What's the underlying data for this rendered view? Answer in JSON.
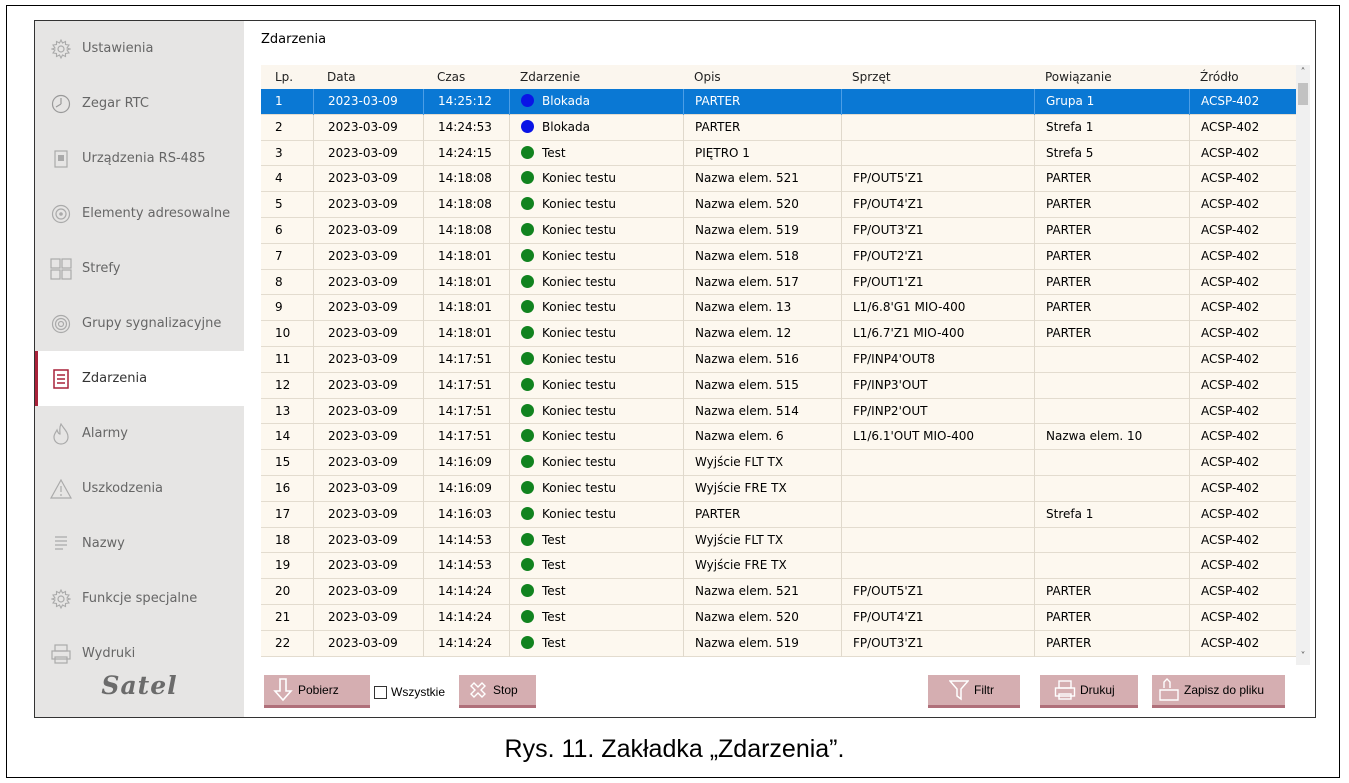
{
  "sidebar": {
    "items": [
      {
        "label": "Ustawienia",
        "icon": "gear-icon"
      },
      {
        "label": "Zegar RTC",
        "icon": "clock-icon"
      },
      {
        "label": "Urządzenia RS-485",
        "icon": "device-icon"
      },
      {
        "label": "Elementy adresowalne",
        "icon": "sensor-icon"
      },
      {
        "label": "Strefy",
        "icon": "grid-icon"
      },
      {
        "label": "Grupy sygnalizacyjne",
        "icon": "signal-icon"
      },
      {
        "label": "Zdarzenia",
        "icon": "events-icon",
        "active": true
      },
      {
        "label": "Alarmy",
        "icon": "flame-icon"
      },
      {
        "label": "Uszkodzenia",
        "icon": "warning-icon"
      },
      {
        "label": "Nazwy",
        "icon": "list-icon"
      },
      {
        "label": "Funkcje specjalne",
        "icon": "gear-icon"
      },
      {
        "label": "Wydruki",
        "icon": "printer-icon"
      }
    ],
    "logo": "Satel"
  },
  "main": {
    "title": "Zdarzenia",
    "columns": [
      "Lp.",
      "Data",
      "Czas",
      "Zdarzenie",
      "Opis",
      "Sprzęt",
      "Powiązanie",
      "Źródło"
    ],
    "rows": [
      {
        "lp": "1",
        "data": "2023-03-09",
        "czas": "14:25:12",
        "status": "blue",
        "zdarzenie": "Blokada",
        "opis": "PARTER",
        "sprzet": "",
        "powiazanie": "Grupa 1",
        "zrodlo": "ACSP-402",
        "selected": true
      },
      {
        "lp": "2",
        "data": "2023-03-09",
        "czas": "14:24:53",
        "status": "blue",
        "zdarzenie": "Blokada",
        "opis": "PARTER",
        "sprzet": "",
        "powiazanie": "Strefa 1",
        "zrodlo": "ACSP-402"
      },
      {
        "lp": "3",
        "data": "2023-03-09",
        "czas": "14:24:15",
        "status": "green",
        "zdarzenie": "Test",
        "opis": "PIĘTRO 1",
        "sprzet": "",
        "powiazanie": "Strefa 5",
        "zrodlo": "ACSP-402"
      },
      {
        "lp": "4",
        "data": "2023-03-09",
        "czas": "14:18:08",
        "status": "green",
        "zdarzenie": "Koniec testu",
        "opis": "Nazwa elem. 521",
        "sprzet": "FP/OUT5'Z1",
        "powiazanie": "PARTER",
        "zrodlo": "ACSP-402"
      },
      {
        "lp": "5",
        "data": "2023-03-09",
        "czas": "14:18:08",
        "status": "green",
        "zdarzenie": "Koniec testu",
        "opis": "Nazwa elem. 520",
        "sprzet": "FP/OUT4'Z1",
        "powiazanie": "PARTER",
        "zrodlo": "ACSP-402"
      },
      {
        "lp": "6",
        "data": "2023-03-09",
        "czas": "14:18:08",
        "status": "green",
        "zdarzenie": "Koniec testu",
        "opis": "Nazwa elem. 519",
        "sprzet": "FP/OUT3'Z1",
        "powiazanie": "PARTER",
        "zrodlo": "ACSP-402"
      },
      {
        "lp": "7",
        "data": "2023-03-09",
        "czas": "14:18:01",
        "status": "green",
        "zdarzenie": "Koniec testu",
        "opis": "Nazwa elem. 518",
        "sprzet": "FP/OUT2'Z1",
        "powiazanie": "PARTER",
        "zrodlo": "ACSP-402"
      },
      {
        "lp": "8",
        "data": "2023-03-09",
        "czas": "14:18:01",
        "status": "green",
        "zdarzenie": "Koniec testu",
        "opis": "Nazwa elem. 517",
        "sprzet": "FP/OUT1'Z1",
        "powiazanie": "PARTER",
        "zrodlo": "ACSP-402"
      },
      {
        "lp": "9",
        "data": "2023-03-09",
        "czas": "14:18:01",
        "status": "green",
        "zdarzenie": "Koniec testu",
        "opis": "Nazwa elem. 13",
        "sprzet": "L1/6.8'G1 MIO-400",
        "powiazanie": "PARTER",
        "zrodlo": "ACSP-402"
      },
      {
        "lp": "10",
        "data": "2023-03-09",
        "czas": "14:18:01",
        "status": "green",
        "zdarzenie": "Koniec testu",
        "opis": "Nazwa elem. 12",
        "sprzet": "L1/6.7'Z1 MIO-400",
        "powiazanie": "PARTER",
        "zrodlo": "ACSP-402"
      },
      {
        "lp": "11",
        "data": "2023-03-09",
        "czas": "14:17:51",
        "status": "green",
        "zdarzenie": "Koniec testu",
        "opis": "Nazwa elem. 516",
        "sprzet": "FP/INP4'OUT8",
        "powiazanie": "",
        "zrodlo": "ACSP-402"
      },
      {
        "lp": "12",
        "data": "2023-03-09",
        "czas": "14:17:51",
        "status": "green",
        "zdarzenie": "Koniec testu",
        "opis": "Nazwa elem. 515",
        "sprzet": "FP/INP3'OUT",
        "powiazanie": "",
        "zrodlo": "ACSP-402"
      },
      {
        "lp": "13",
        "data": "2023-03-09",
        "czas": "14:17:51",
        "status": "green",
        "zdarzenie": "Koniec testu",
        "opis": "Nazwa elem. 514",
        "sprzet": "FP/INP2'OUT",
        "powiazanie": "",
        "zrodlo": "ACSP-402"
      },
      {
        "lp": "14",
        "data": "2023-03-09",
        "czas": "14:17:51",
        "status": "green",
        "zdarzenie": "Koniec testu",
        "opis": "Nazwa elem. 6",
        "sprzet": "L1/6.1'OUT MIO-400",
        "powiazanie": "Nazwa elem. 10",
        "zrodlo": "ACSP-402"
      },
      {
        "lp": "15",
        "data": "2023-03-09",
        "czas": "14:16:09",
        "status": "green",
        "zdarzenie": "Koniec testu",
        "opis": "Wyjście FLT TX",
        "sprzet": "",
        "powiazanie": "",
        "zrodlo": "ACSP-402"
      },
      {
        "lp": "16",
        "data": "2023-03-09",
        "czas": "14:16:09",
        "status": "green",
        "zdarzenie": "Koniec testu",
        "opis": "Wyjście FRE TX",
        "sprzet": "",
        "powiazanie": "",
        "zrodlo": "ACSP-402"
      },
      {
        "lp": "17",
        "data": "2023-03-09",
        "czas": "14:16:03",
        "status": "green",
        "zdarzenie": "Koniec testu",
        "opis": "PARTER",
        "sprzet": "",
        "powiazanie": "Strefa 1",
        "zrodlo": "ACSP-402"
      },
      {
        "lp": "18",
        "data": "2023-03-09",
        "czas": "14:14:53",
        "status": "green",
        "zdarzenie": "Test",
        "opis": "Wyjście FLT TX",
        "sprzet": "",
        "powiazanie": "",
        "zrodlo": "ACSP-402"
      },
      {
        "lp": "19",
        "data": "2023-03-09",
        "czas": "14:14:53",
        "status": "green",
        "zdarzenie": "Test",
        "opis": "Wyjście FRE TX",
        "sprzet": "",
        "powiazanie": "",
        "zrodlo": "ACSP-402"
      },
      {
        "lp": "20",
        "data": "2023-03-09",
        "czas": "14:14:24",
        "status": "green",
        "zdarzenie": "Test",
        "opis": "Nazwa elem. 521",
        "sprzet": "FP/OUT5'Z1",
        "powiazanie": "PARTER",
        "zrodlo": "ACSP-402"
      },
      {
        "lp": "21",
        "data": "2023-03-09",
        "czas": "14:14:24",
        "status": "green",
        "zdarzenie": "Test",
        "opis": "Nazwa elem. 520",
        "sprzet": "FP/OUT4'Z1",
        "powiazanie": "PARTER",
        "zrodlo": "ACSP-402"
      },
      {
        "lp": "22",
        "data": "2023-03-09",
        "czas": "14:14:24",
        "status": "green",
        "zdarzenie": "Test",
        "opis": "Nazwa elem. 519",
        "sprzet": "FP/OUT3'Z1",
        "powiazanie": "PARTER",
        "zrodlo": "ACSP-402"
      }
    ],
    "status_colors": {
      "blue": "#0a14e6",
      "green": "#11831f"
    },
    "selection_color": "#0a78d4"
  },
  "toolbar": {
    "pobierz": "Pobierz",
    "wszystkie": "Wszystkie",
    "stop": "Stop",
    "filtr": "Filtr",
    "drukuj": "Drukuj",
    "zapisz": "Zapisz do pliku"
  },
  "caption": "Rys. 11. Zakładka „Zdarzenia”."
}
